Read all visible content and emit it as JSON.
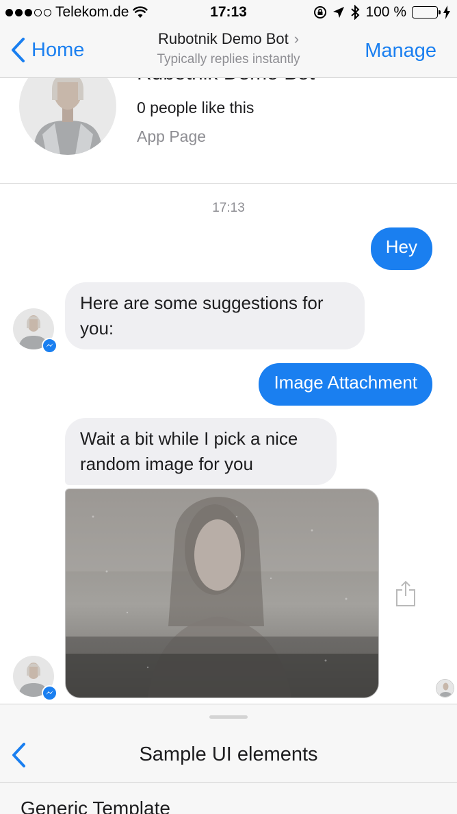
{
  "status_bar": {
    "carrier": "Telekom.de",
    "time": "17:13",
    "battery": "100 %",
    "battery_level": 1.0
  },
  "nav": {
    "back_label": "Home",
    "title": "Rubotnik Demo Bot",
    "subtitle": "Typically replies instantly",
    "manage_label": "Manage"
  },
  "profile": {
    "name": "Rubotnik Demo Bot",
    "likes": "0 people like this",
    "type": "App Page"
  },
  "chat": {
    "timestamp": "17:13",
    "messages": [
      {
        "from": "user",
        "text": "Hey"
      },
      {
        "from": "bot",
        "text": "Here are some suggestions for you:"
      },
      {
        "from": "user",
        "text": "Image Attachment"
      },
      {
        "from": "bot",
        "text": "Wait a bit while I pick a nice random image for you"
      }
    ]
  },
  "panel": {
    "title": "Sample UI elements",
    "item": "Generic Template"
  },
  "colors": {
    "accent": "#1a7ff0",
    "bubble_in": "#efeff2",
    "muted": "#8e8e93"
  }
}
